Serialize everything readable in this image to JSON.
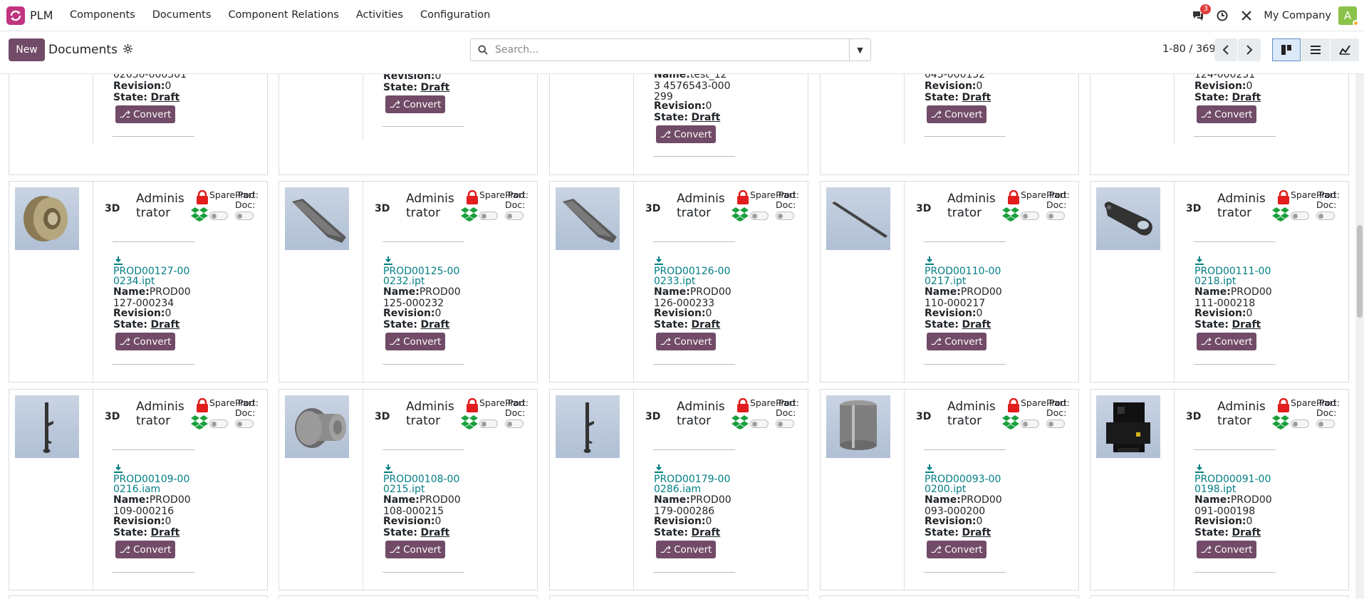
{
  "app": {
    "name": "PLM",
    "menu": [
      "Components",
      "Documents",
      "Component Relations",
      "Activities",
      "Configuration"
    ],
    "chat_badge": "3",
    "company": "My Company",
    "avatar_letter": "A",
    "brand_color": "#714b67"
  },
  "control": {
    "new_label": "New",
    "title": "Documents",
    "search_placeholder": "Search...",
    "pager": "1-80 / 369"
  },
  "labels": {
    "tag3d": "3D",
    "spare_part": "Spare Part:",
    "prod_doc": "Prod Doc:",
    "name": "Name:",
    "revision": "Revision:",
    "state": "State:",
    "convert": "Convert"
  },
  "top_row_partial": [
    {
      "name_tail": "02030-000301",
      "revision": "0",
      "state": "Draft"
    },
    {
      "revision": "0",
      "state": "Draft"
    },
    {
      "name": "test_123 4576543-000299",
      "revision": "0",
      "state": "Draft"
    },
    {
      "name_tail": "045-000152",
      "revision": "0",
      "state": "Draft"
    },
    {
      "name_tail": "124-000251",
      "revision": "0",
      "state": "Draft"
    }
  ],
  "cards": [
    {
      "author": "Administrator",
      "file": "PROD00127-000234.ipt",
      "name": "PROD00127-000234",
      "revision": "0",
      "state": "Draft",
      "shape": "pulley"
    },
    {
      "author": "Administrator",
      "file": "PROD00125-000232.ipt",
      "name": "PROD00125-000232",
      "revision": "0",
      "state": "Draft",
      "shape": "blade"
    },
    {
      "author": "Administrator",
      "file": "PROD00126-000233.ipt",
      "name": "PROD00126-000233",
      "revision": "0",
      "state": "Draft",
      "shape": "blade"
    },
    {
      "author": "Administrator",
      "file": "PROD00110-000217.ipt",
      "name": "PROD00110-000217",
      "revision": "0",
      "state": "Draft",
      "shape": "rod"
    },
    {
      "author": "Administrator",
      "file": "PROD00111-000218.ipt",
      "name": "PROD00111-000218",
      "revision": "0",
      "state": "Draft",
      "shape": "link"
    },
    {
      "author": "Administrator",
      "file": "PROD00109-000216.iam",
      "name": "PROD00109-000216",
      "revision": "0",
      "state": "Draft",
      "shape": "shaft"
    },
    {
      "author": "Administrator",
      "file": "PROD00108-000215.ipt",
      "name": "PROD00108-000215",
      "revision": "0",
      "state": "Draft",
      "shape": "cylinder"
    },
    {
      "author": "Administrator",
      "file": "PROD00179-000286.iam",
      "name": "PROD00179-000286",
      "revision": "0",
      "state": "Draft",
      "shape": "shaft"
    },
    {
      "author": "Administrator",
      "file": "PROD00093-000200.ipt",
      "name": "PROD00093-000200",
      "revision": "0",
      "state": "Draft",
      "shape": "sleeve"
    },
    {
      "author": "Administrator",
      "file": "PROD00091-000198.ipt",
      "name": "PROD00091-000198",
      "revision": "0",
      "state": "Draft",
      "shape": "block"
    }
  ]
}
